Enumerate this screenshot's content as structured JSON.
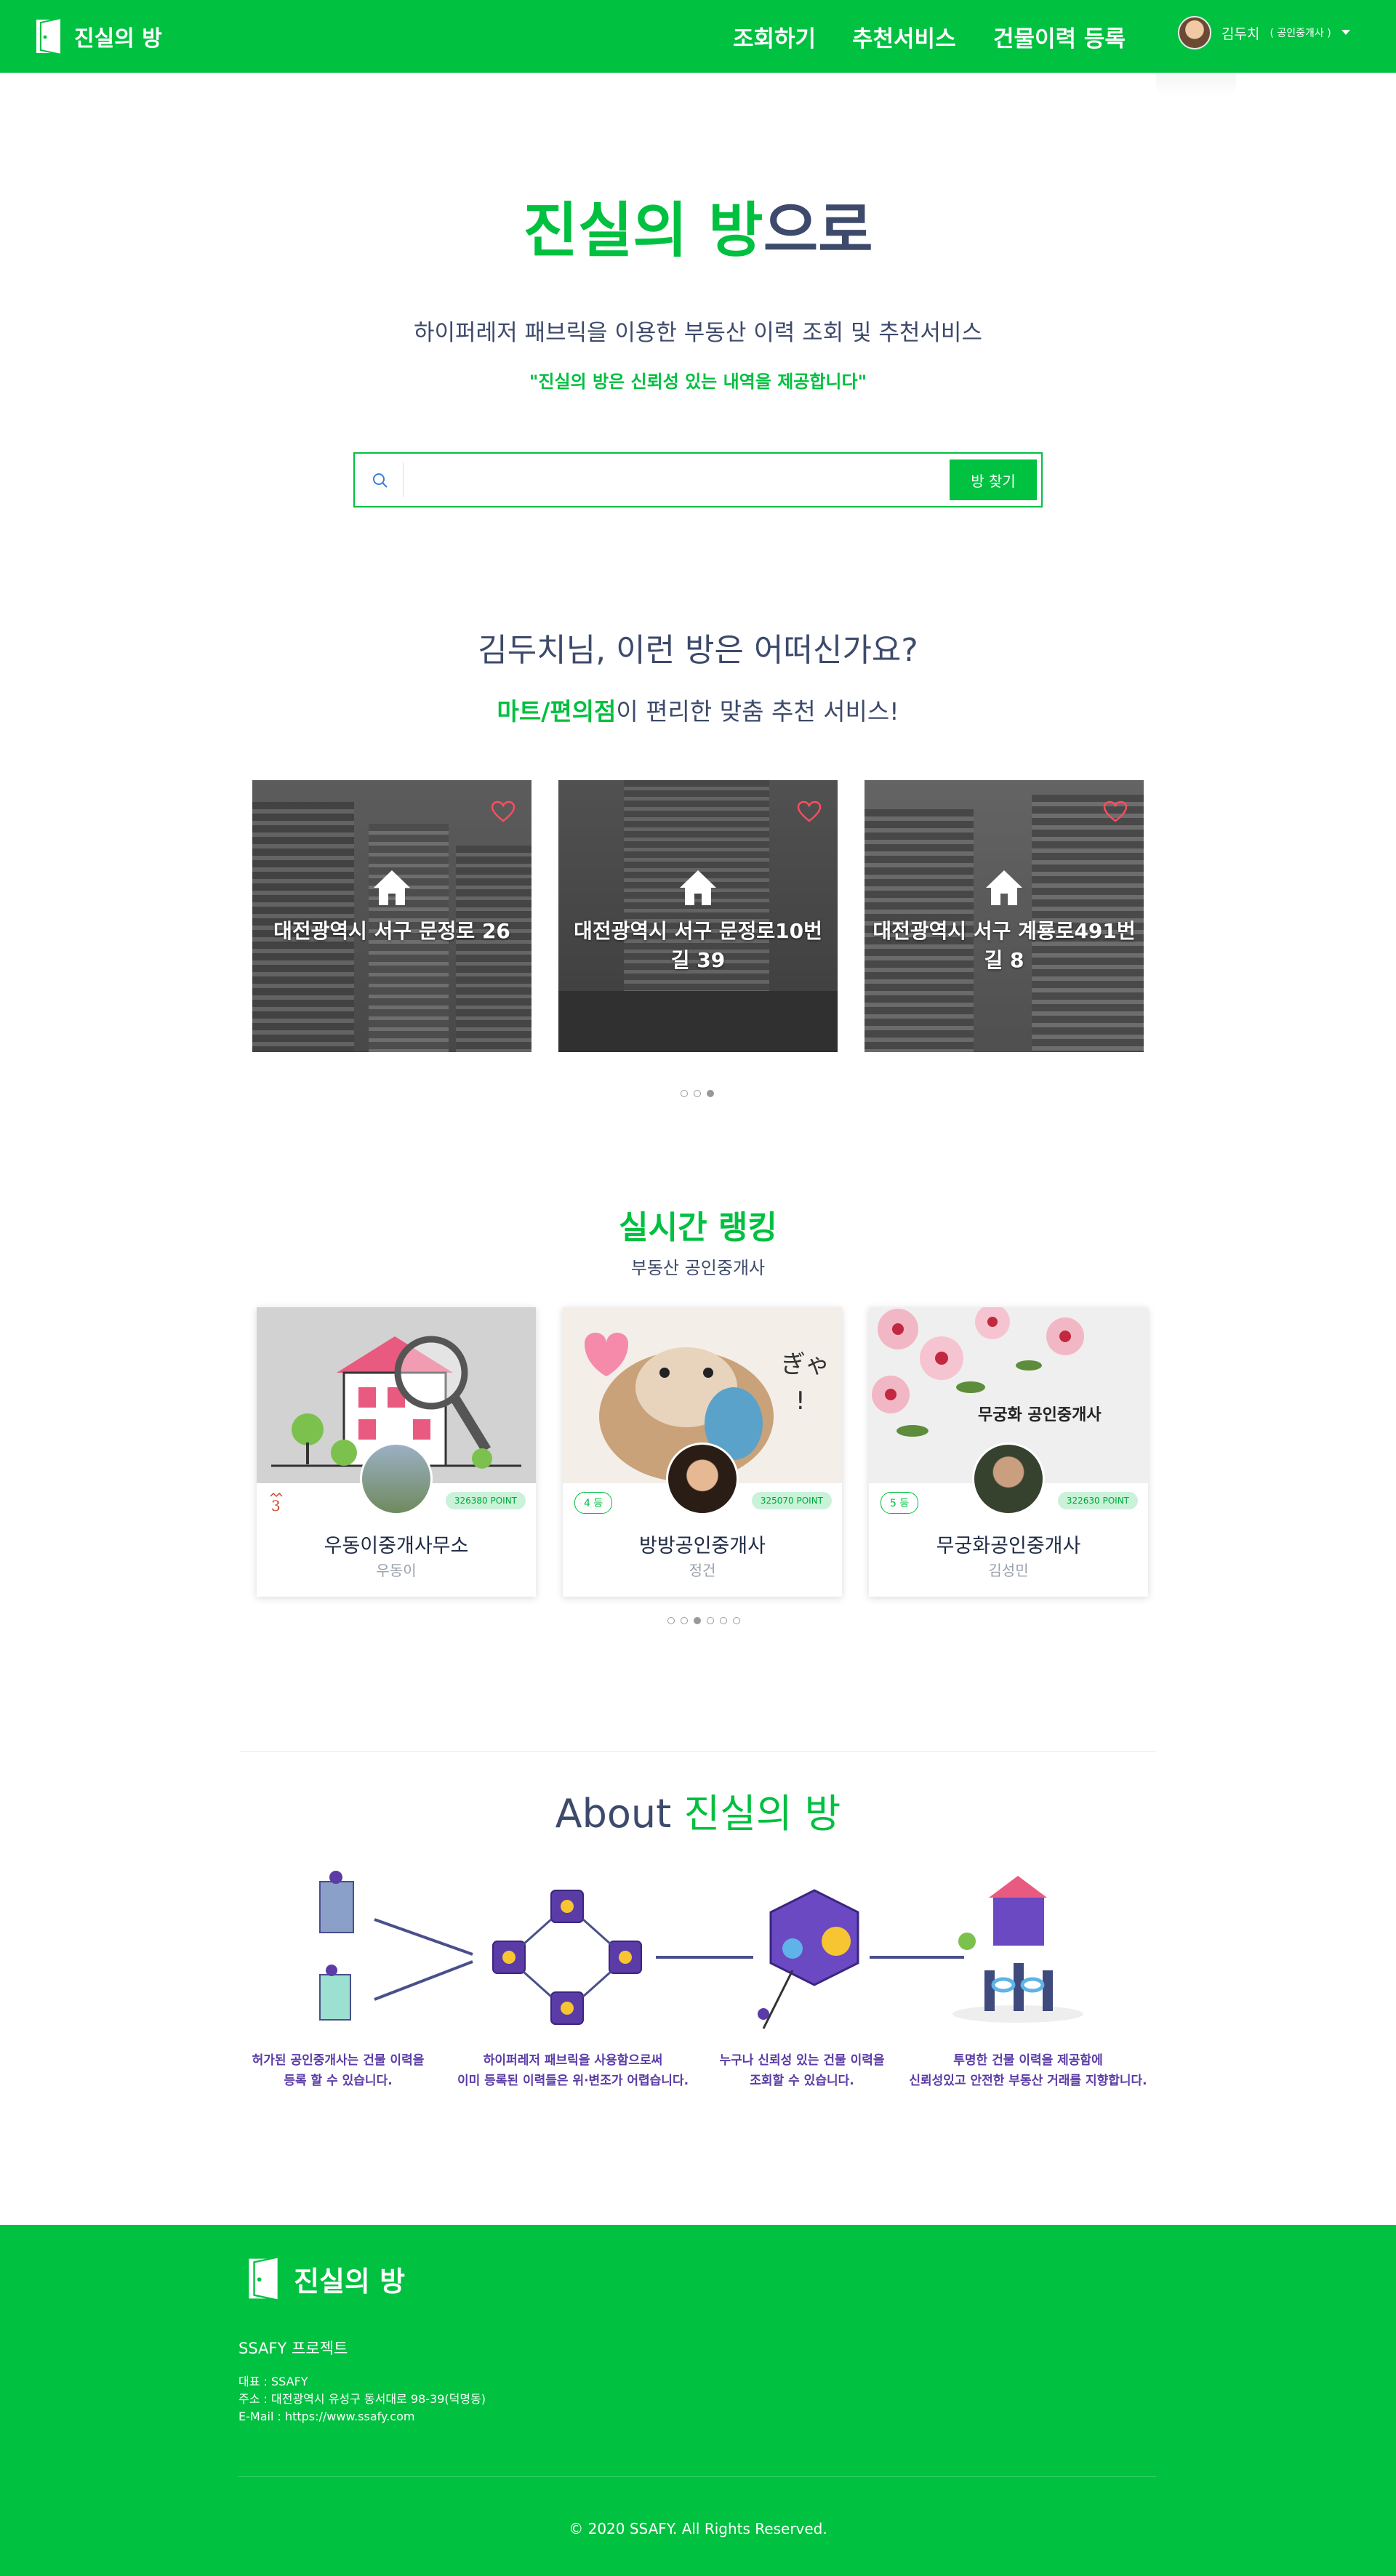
{
  "nav": {
    "brand": "진실의 방",
    "menu": [
      "조회하기",
      "추천서비스",
      "건물이력 등록"
    ],
    "user_name": "김두치",
    "user_type": "( 공인중개사 )"
  },
  "hero": {
    "title_green": "진실의 방",
    "title_rest": "으로",
    "subtitle": "하이퍼레저 패브릭을 이용한 부동산 이력 조회 및 추천서비스",
    "quote": "\"진실의 방은 신뢰성 있는 내역을 제공합니다\"",
    "search_placeholder": "",
    "search_button": "방 찾기"
  },
  "recommend": {
    "title": "김두치님, 이런 방은 어떠신가요?",
    "sub_highlight": "마트/편의점",
    "sub_rest": "이 편리한 맞춤 추천 서비스!",
    "cards": [
      {
        "address": "대전광역시 서구 문정로 26"
      },
      {
        "address": "대전광역시 서구 문정로10번길 39"
      },
      {
        "address": "대전광역시 서구 계룡로491번길 8"
      }
    ]
  },
  "ranking": {
    "title": "실시간 랭킹",
    "subtitle": "부동산 공인중개사",
    "cards": [
      {
        "rank": "3",
        "points": "326380 POINT",
        "name": "우동이중개사무소",
        "owner": "우동이"
      },
      {
        "rank": "4 등",
        "points": "325070 POINT",
        "name": "방방공인중개사",
        "owner": "정건"
      },
      {
        "rank": "5 등",
        "points": "322630 POINT",
        "name": "무궁화공인중개사",
        "owner": "김성민",
        "image_caption": "무궁화 공인중개사"
      }
    ]
  },
  "about": {
    "title_plain": "About ",
    "title_green": "진실의 방",
    "steps": [
      {
        "line1": "허가된 공인중개사는 건물 이력을",
        "line2": "등록 할 수 있습니다."
      },
      {
        "line1": "하이퍼레저 패브릭을 사용함으로써",
        "line2": "이미 등록된 이력들은 위·변조가 어렵습니다."
      },
      {
        "line1": "누구나 신뢰성 있는 건물 이력을",
        "line2": "조회할 수 있습니다."
      },
      {
        "line1": "투명한 건물 이력을 제공함에",
        "line2": "신뢰성있고 안전한 부동산 거래를 지향합니다."
      }
    ]
  },
  "footer": {
    "brand": "진실의 방",
    "project": "SSAFY 프로젝트",
    "rep": "대표 : SSAFY",
    "address": "주소 : 대전광역시 유성구 동서대로 98-39(덕명동)",
    "email": "E-Mail : https://www.ssafy.com",
    "copyright": "© 2020 SSAFY. All Rights Reserved."
  },
  "colors": {
    "brand_green": "#00c140",
    "text_navy": "#3d4a6b",
    "about_purple": "#5b3ba6"
  }
}
